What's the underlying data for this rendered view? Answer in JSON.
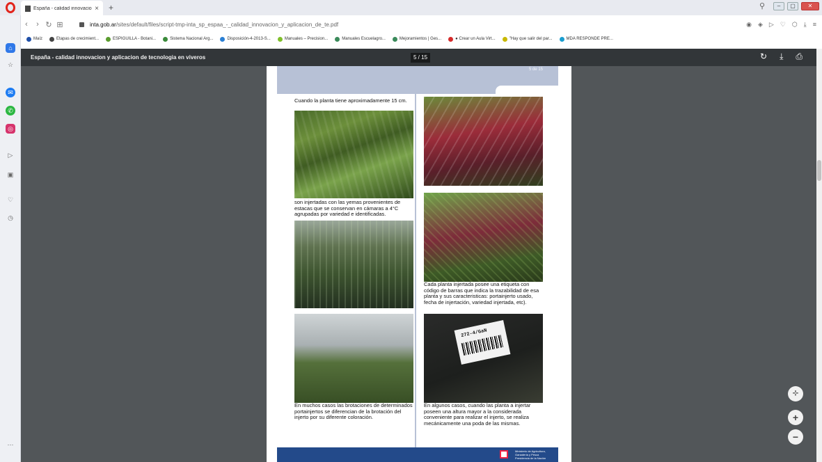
{
  "browser": {
    "tab_title": "España - calidad innovacion",
    "url_domain": "inta.gob.ar",
    "url_path": "/sites/default/files/script-tmp-inta_sp_espaa_-_calidad_innovacion_y_aplicacion_de_te.pdf",
    "bookmarks": [
      {
        "label": "Maíz",
        "color": "#1f4fa8"
      },
      {
        "label": "Etapas de crecimient...",
        "color": "#444444"
      },
      {
        "label": "ESPIGUILLA - Botani...",
        "color": "#5a9c2e"
      },
      {
        "label": "Sistema Nacional Arg...",
        "color": "#3a8a3a"
      },
      {
        "label": "Disposición-4-2013-S...",
        "color": "#2a7fd4"
      },
      {
        "label": "Manuales – Precision...",
        "color": "#7fbf2a"
      },
      {
        "label": "Manuales Escuelagro...",
        "color": "#3a8a5a"
      },
      {
        "label": "Mejoramientos | Ges...",
        "color": "#3a8a5a"
      },
      {
        "label": "● Crear un Aula Virt...",
        "color": "#d52b2b"
      },
      {
        "label": "\"Hay que salir del par...",
        "color": "#c8b800"
      },
      {
        "label": "MDA RESPONDE PRE...",
        "color": "#1a9dcf"
      }
    ]
  },
  "pdf": {
    "title": "España - calidad innovacion y aplicacion de tecnologia en viveros",
    "page_indicator": "5 / 15",
    "page_number_text": "5 de 15",
    "captions": {
      "c1": "Cuando la planta tiene aproximadamente 15 cm.",
      "c2": "son injertadas con las yemas provenientes de estacas que se conservan en cámaras a 4°C agrupadas por variedad e identificadas.",
      "c3": "En muchos casos las brotaciones de determinados portainjertos se diferencian de la brotación del injerto por su diferente coloración.",
      "c4": "Cada planta injertada posee una etiqueta con código de barras que indica la trazabilidad de esa planta y sus caracteristicas: portainjerto usado, fecha de injertación, variedad injertada, etc).",
      "c5": "En algunos casos, cuando las planta a injertar poseen una altura mayor a la considerada conveniente para realizar el injerto, se realiza mecánicamente una poda de las mismas."
    },
    "barcode_label": "272-4/GaN",
    "footer_ministry": "Ministerio de Agricultura, Ganadería y Pesca Presidencia de la Nación"
  },
  "colors": {
    "toolbar": "#323639",
    "viewer_bg": "#525659",
    "header_band": "#b7c1d6",
    "footer_band": "#234a8a"
  }
}
